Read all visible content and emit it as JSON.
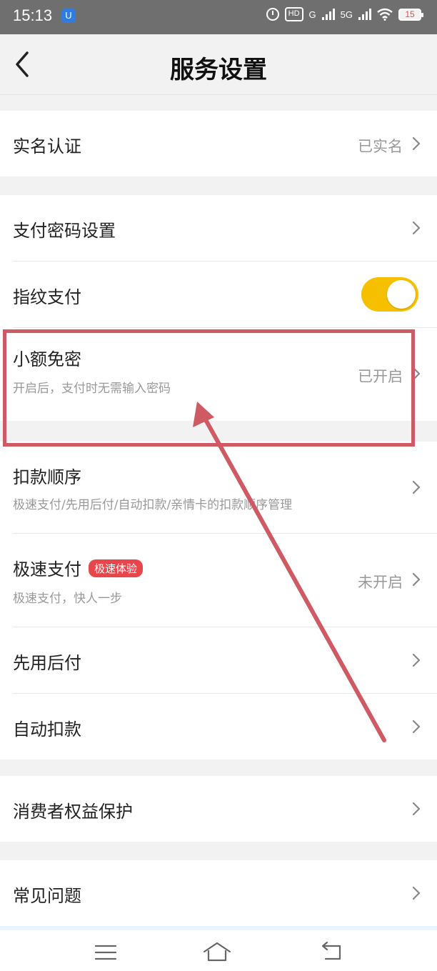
{
  "status": {
    "time": "15:13",
    "app_badge": "U",
    "hd": "HD",
    "sim1": "G",
    "sim2": "5G",
    "battery": "15"
  },
  "nav": {
    "title": "服务设置"
  },
  "rows": {
    "realname": {
      "title": "实名认证",
      "value": "已实名"
    },
    "paypwd": {
      "title": "支付密码设置"
    },
    "fingerprint": {
      "title": "指纹支付",
      "toggle_on": true
    },
    "smallfree": {
      "title": "小额免密",
      "subtitle": "开启后，支付时无需输入密码",
      "value": "已开启"
    },
    "order": {
      "title": "扣款顺序",
      "subtitle": "极速支付/先用后付/自动扣款/亲情卡的扣款顺序管理"
    },
    "fastpay": {
      "title": "极速支付",
      "tag": "极速体验",
      "subtitle": "极速支付，快人一步",
      "value": "未开启"
    },
    "paylater": {
      "title": "先用后付"
    },
    "autodebit": {
      "title": "自动扣款"
    },
    "consumer": {
      "title": "消费者权益保护"
    },
    "faq": {
      "title": "常见问题"
    }
  },
  "colors": {
    "toggle": "#f6c000",
    "highlight": "#cf5a63",
    "tag": "#e8464b"
  }
}
